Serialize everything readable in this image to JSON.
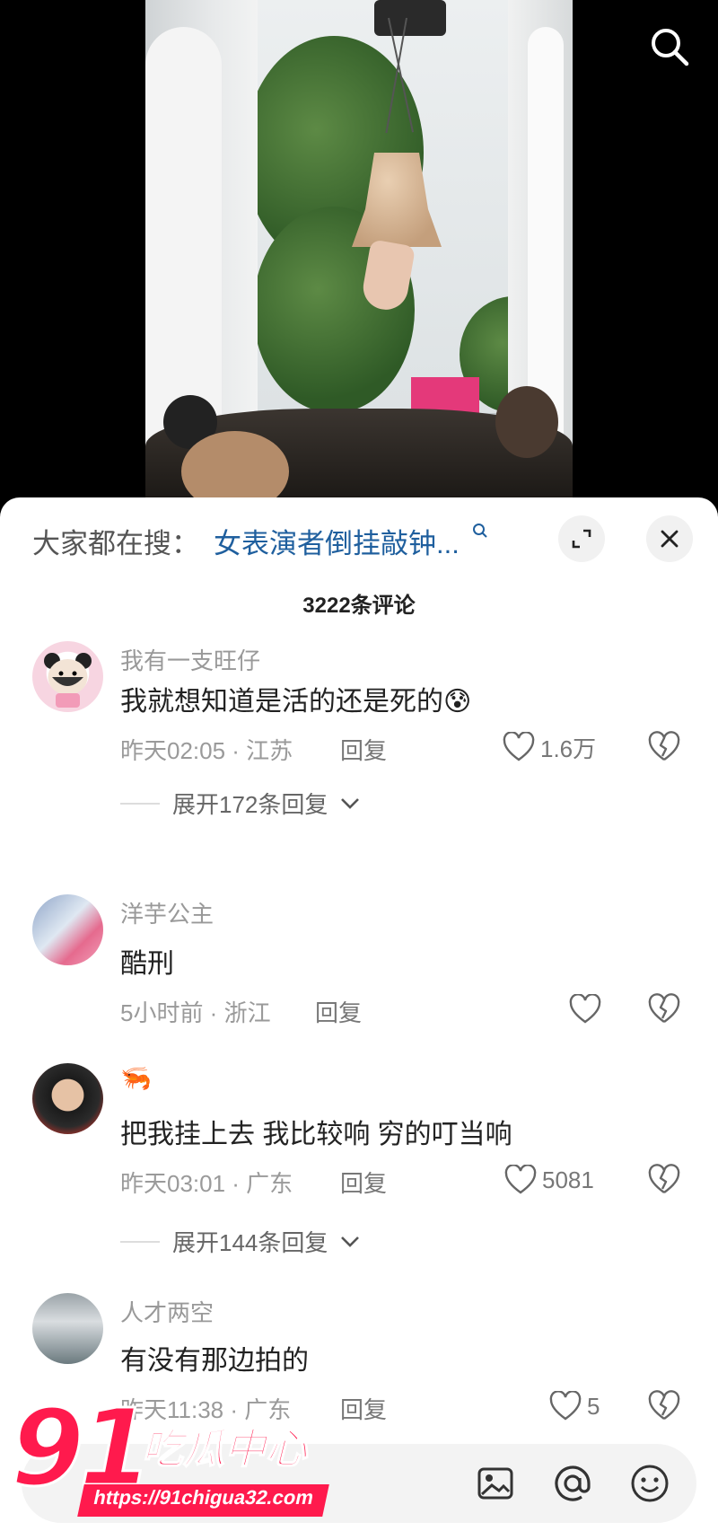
{
  "trending": {
    "prefix": "大家都在搜：",
    "query": "女表演者倒挂敲钟..."
  },
  "comments_count": "3222条评论",
  "comments": [
    {
      "username": "我有一支旺仔",
      "text": "我就想知道是活的还是死的",
      "emoji": "😰",
      "time_location": "昨天02:05 · 江苏",
      "reply_label": "回复",
      "likes": "1.6万",
      "expand_replies": "展开172条回复"
    },
    {
      "username": "洋芋公主",
      "text": "酷刑",
      "time_location": "5小时前 · 浙江",
      "reply_label": "回复",
      "likes": ""
    },
    {
      "username": "",
      "text": "把我挂上去 我比较响 穷的叮当响",
      "time_location": "昨天03:01 · 广东",
      "reply_label": "回复",
      "likes": "5081",
      "expand_replies": "展开144条回复"
    },
    {
      "username": "人才两空",
      "text": "有没有那边拍的",
      "time_location": "昨天11:38 · 广东",
      "reply_label": "回复",
      "likes": "5"
    }
  ],
  "input": {
    "placeholder": ""
  },
  "watermark": {
    "number": "91",
    "name": "吃瓜中心",
    "url": "https://91chigua32.com"
  },
  "icons": {
    "search": "search-icon",
    "expand": "expand-icon",
    "close": "close-icon",
    "like": "heart-outline-icon",
    "dislike": "broken-heart-icon",
    "image": "image-icon",
    "mention": "at-icon",
    "emoji": "smiley-icon",
    "chevron": "chevron-down-icon"
  },
  "colors": {
    "link": "#1f5f9e",
    "watermark": "#ff1a4d"
  }
}
